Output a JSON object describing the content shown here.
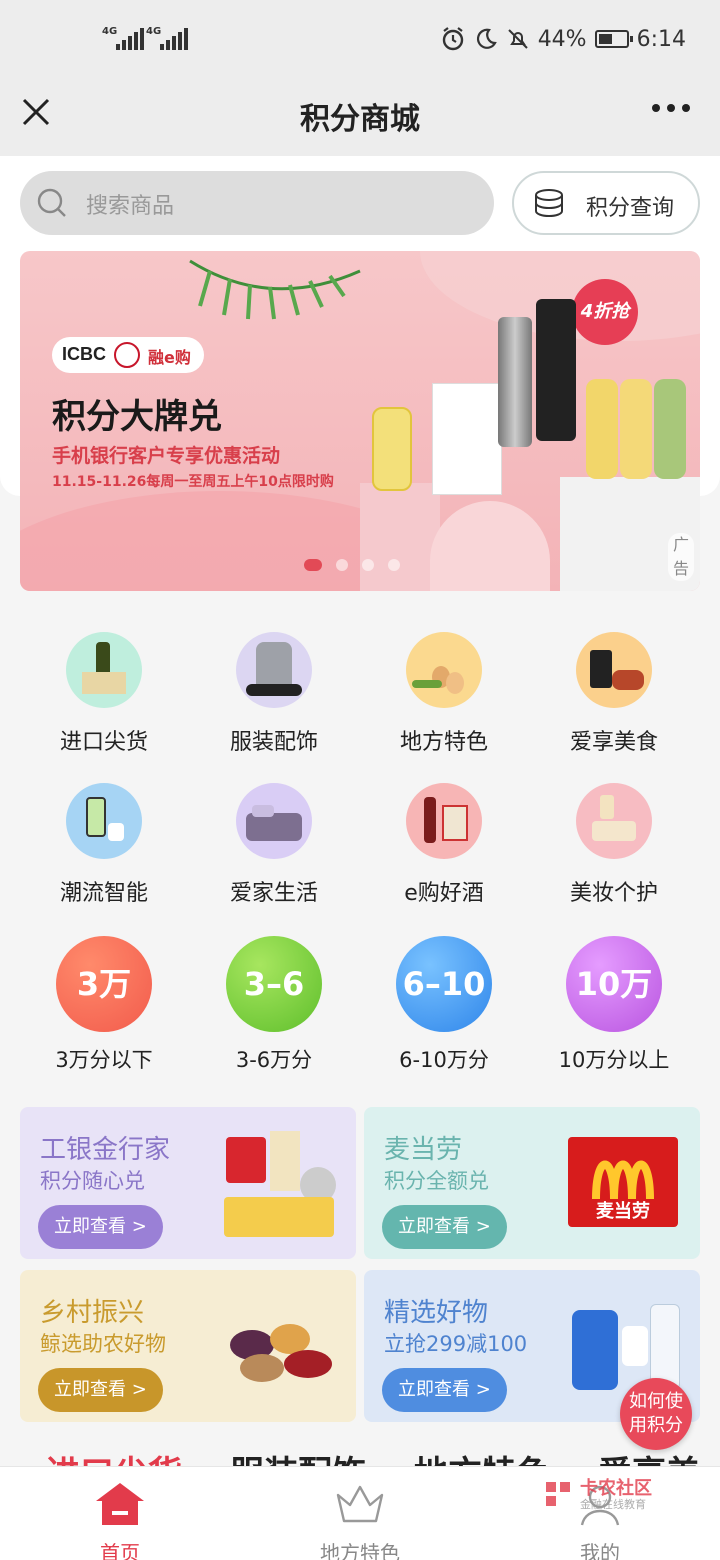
{
  "status_bar": {
    "signal_1": "4G",
    "signal_2": "4G",
    "battery": "44%",
    "time": "6:14"
  },
  "nav": {
    "title": "积分商城"
  },
  "search": {
    "placeholder": "搜索商品",
    "points_query": "积分查询"
  },
  "banner": {
    "logo_text": "ICBC",
    "logo_brand": "融e购",
    "title": "积分大牌兑",
    "subtitle": "手机银行客户专享优惠活动",
    "date_text": "11.15-11.26每周一至周五上午10点限时购",
    "discount_badge": "4折抢",
    "ad_tag": "广告",
    "active_slide": 1,
    "slide_count": 4
  },
  "categories": [
    {
      "label": "进口尖货",
      "icon": "olive-oil-icon"
    },
    {
      "label": "服装配饰",
      "icon": "jacket-icon"
    },
    {
      "label": "地方特色",
      "icon": "eggs-icon"
    },
    {
      "label": "爱享美食",
      "icon": "snacks-icon"
    },
    {
      "label": "潮流智能",
      "icon": "phone-icon"
    },
    {
      "label": "爱家生活",
      "icon": "bedding-icon"
    },
    {
      "label": "e购好酒",
      "icon": "wine-icon"
    },
    {
      "label": "美妆个护",
      "icon": "cosmetics-icon"
    }
  ],
  "point_ranges": [
    {
      "badge": "3万",
      "label": "3万分以下",
      "color": "#f25b4c"
    },
    {
      "badge": "3–6",
      "label": "3-6万分",
      "color": "#6fcf3b"
    },
    {
      "badge": "6–10",
      "label": "6-10万分",
      "color": "#3f96f2"
    },
    {
      "badge": "10万",
      "label": "10万分以上",
      "color": "#c966e6"
    }
  ],
  "promos": [
    {
      "title": "工银金行家",
      "subtitle": "积分随心兑",
      "button": "立即查看 >"
    },
    {
      "title": "麦当劳",
      "subtitle": "积分全额兑",
      "button": "立即查看 >",
      "logo_text": "麦当劳"
    },
    {
      "title": "乡村振兴",
      "subtitle": "鲸选助农好物",
      "button": "立即查看 >"
    },
    {
      "title": "精选好物",
      "subtitle": "立抢299减100",
      "button": "立即查看 >"
    }
  ],
  "help_fab": {
    "line1": "如何使",
    "line2": "用积分"
  },
  "section_tabs": [
    "进口尖货",
    "服装配饰",
    "地方特色",
    "爱享美食"
  ],
  "bottom_nav": [
    {
      "label": "首页",
      "active": true
    },
    {
      "label": "地方特色",
      "active": false
    },
    {
      "label": "我的",
      "active": false
    }
  ],
  "watermark": {
    "text": "卡农社区",
    "sub": "金融在线教育"
  },
  "colors": {
    "accent": "#e23b4b",
    "nav_bg": "#ededed",
    "banner_bg": "#f3b3b7"
  }
}
